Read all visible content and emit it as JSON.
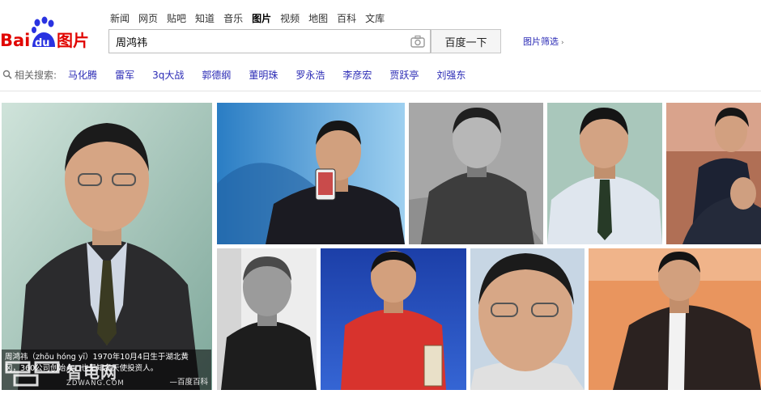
{
  "logo": {
    "text_bai": "Bai",
    "text_du": "du",
    "text_suffix": "图片"
  },
  "nav": [
    {
      "label": "新闻",
      "active": false
    },
    {
      "label": "网页",
      "active": false
    },
    {
      "label": "贴吧",
      "active": false
    },
    {
      "label": "知道",
      "active": false
    },
    {
      "label": "音乐",
      "active": false
    },
    {
      "label": "图片",
      "active": true
    },
    {
      "label": "视频",
      "active": false
    },
    {
      "label": "地图",
      "active": false
    },
    {
      "label": "百科",
      "active": false
    },
    {
      "label": "文库",
      "active": false
    }
  ],
  "search": {
    "value": "周鸿祎",
    "button_label": "百度一下"
  },
  "filter": {
    "label": "图片筛选"
  },
  "related": {
    "label": "相关搜索:",
    "items": [
      "马化腾",
      "雷军",
      "3q大战",
      "郭德纲",
      "董明珠",
      "罗永浩",
      "李彦宏",
      "贾跃亭",
      "刘强东"
    ]
  },
  "caption": {
    "line1": "周鸿祎（zhōu hóng yī）1970年10月4日生于湖北黄",
    "line2": "冈，360公司创始人，也是知名天使投资人。",
    "source": "—百度百科"
  },
  "watermark": {
    "cn": "智电网",
    "en": "ZDWANG.COM"
  },
  "colors": {
    "brand_red": "#e10602",
    "brand_blue": "#2932e1",
    "link_blue": "#2a2ab5"
  }
}
